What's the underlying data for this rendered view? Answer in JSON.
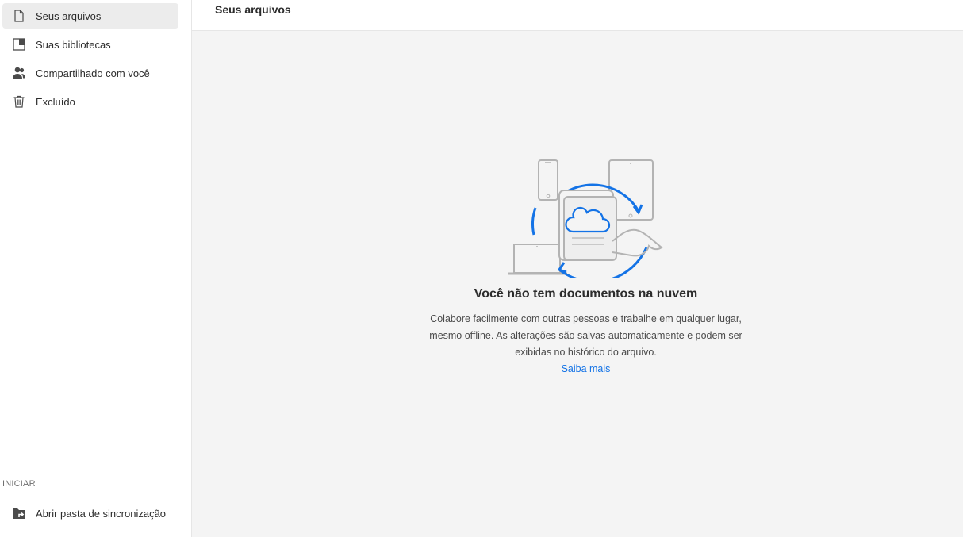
{
  "sidebar": {
    "items": [
      {
        "label": "Seus arquivos",
        "icon": "file-icon",
        "selected": true
      },
      {
        "label": "Suas bibliotecas",
        "icon": "library-icon",
        "selected": false
      },
      {
        "label": "Compartilhado com você",
        "icon": "people-icon",
        "selected": false
      },
      {
        "label": "Excluído",
        "icon": "trash-icon",
        "selected": false
      }
    ],
    "section_label": "INICIAR",
    "bottom_item": {
      "label": "Abrir pasta de sincronização",
      "icon": "sync-folder-icon"
    }
  },
  "header": {
    "title": "Seus arquivos"
  },
  "empty_state": {
    "title": "Você não tem documentos na nuvem",
    "description": "Colabore facilmente com outras pessoas e trabalhe em qualquer lugar, mesmo offline. As alterações são salvas automaticamente e podem ser exibidas no histórico do arquivo.",
    "link": "Saiba mais"
  },
  "colors": {
    "accent": "#1473e6",
    "selected_bg": "#ececec",
    "main_bg": "#f4f4f4"
  }
}
